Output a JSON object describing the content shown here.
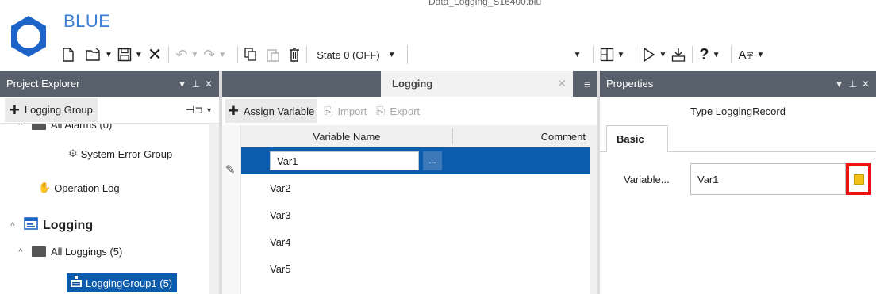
{
  "app": {
    "title": "BLUE",
    "file_name": "Data_Logging_S16400.blu"
  },
  "toolbar": {
    "state_label": "State 0 (OFF)",
    "state_value": ""
  },
  "project_explorer": {
    "title": "Project Explorer",
    "add_button_label": "Logging Group",
    "tree": [
      {
        "label": "All Alarms (0)"
      },
      {
        "label": "System Error Group"
      },
      {
        "label": "Operation Log"
      },
      {
        "label": "Logging"
      },
      {
        "label": "All Loggings (5)"
      },
      {
        "label": "LoggingGroup1 (5)"
      }
    ]
  },
  "logging": {
    "tab_label": "Logging",
    "assign_label": "Assign Variable",
    "import_label": "Import",
    "export_label": "Export",
    "columns": [
      "Variable Name",
      "Comment"
    ],
    "rows": [
      "Var1",
      "Var2",
      "Var3",
      "Var4",
      "Var5"
    ],
    "edit_button_label": "..."
  },
  "properties": {
    "title": "Properties",
    "type_label": "Type  LoggingRecord",
    "tab_basic": "Basic",
    "variable_label": "Variable...",
    "variable_value": "Var1"
  },
  "colors": {
    "header_bar": "#58616b",
    "selection": "#0b5cad",
    "accent_title": "#3a7fd5",
    "highlight_border": "#ee1111",
    "variable_button_fill": "#f2c018"
  }
}
